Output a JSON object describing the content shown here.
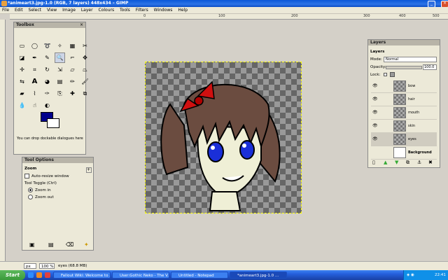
{
  "window": {
    "title": "*animeart3.jpg-1.0 (RGB, 7 layers) 448x434 – GIMP"
  },
  "menu": [
    "File",
    "Edit",
    "Select",
    "View",
    "Image",
    "Layer",
    "Colours",
    "Tools",
    "Filters",
    "Windows",
    "Help"
  ],
  "ruler": {
    "ticks": [
      "0",
      "100",
      "200",
      "300",
      "400",
      "500"
    ]
  },
  "toolbox": {
    "title": "Toolbox",
    "hint": "You can drop dockable dialogues here",
    "tools": [
      "rect-select",
      "ellipse-select",
      "free-select",
      "fuzzy-select",
      "select-by-color",
      "scissors",
      "foreground-select",
      "paths",
      "color-picker",
      "zoom",
      "measure",
      "move",
      "align",
      "crop",
      "rotate",
      "scale",
      "shear",
      "perspective",
      "flip",
      "text",
      "bucket-fill",
      "blend",
      "pencil",
      "paintbrush",
      "eraser",
      "airbrush",
      "ink",
      "clone",
      "heal",
      "perspective-clone",
      "blur",
      "smudge",
      "dodge-burn"
    ],
    "colors": {
      "foreground": "#00008b",
      "background": "#ffffff"
    }
  },
  "tool_options": {
    "title": "Tool Options",
    "heading": "Zoom",
    "auto_resize": "Auto-resize window",
    "toggle": "Tool Toggle  (Ctrl)",
    "zoom_in": "Zoom in",
    "zoom_out": "Zoom out"
  },
  "layers": {
    "panel_title": "Layers",
    "tab_title": "Layers",
    "mode_label": "Mode:",
    "mode_value": "Normal",
    "opacity_label": "Opacity:",
    "opacity_value": "100.0",
    "lock_label": "Lock:",
    "items": [
      {
        "name": "bow"
      },
      {
        "name": "hair"
      },
      {
        "name": "mouth"
      },
      {
        "name": "skin"
      },
      {
        "name": "eyes"
      },
      {
        "name": "Background"
      }
    ]
  },
  "status": {
    "unit": "px",
    "zoom": "100 %",
    "info": "eyes (68.8 MB)"
  },
  "taskbar": {
    "start": "Start",
    "tasks": [
      "Fallout Wiki: Welcome to ...",
      "User:Gothic Neko - The V...",
      "Untitled - Notepad",
      "*animeart3.jpg-1.0 ..."
    ],
    "clock": "22:41"
  }
}
